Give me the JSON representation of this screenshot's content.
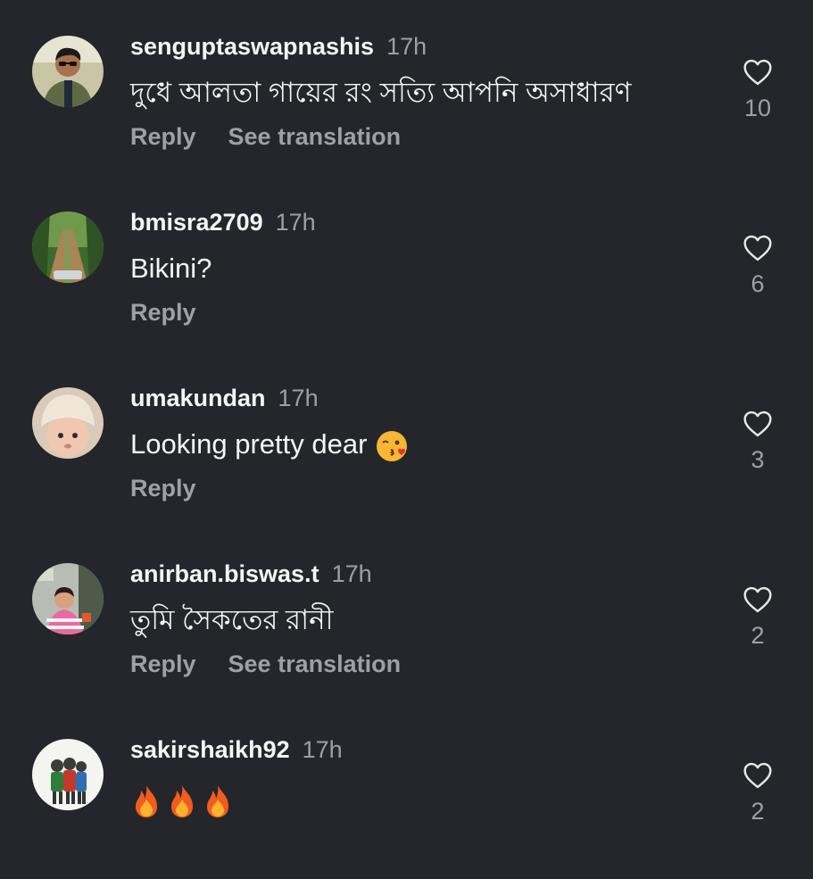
{
  "comments": [
    {
      "username": "senguptaswapnashis",
      "time": "17h",
      "text": "দুধে আলতা গায়ের রং সত্যি আপনি অসাধারণ",
      "reply_label": "Reply",
      "translate_label": "See translation",
      "likes": "10",
      "avatar_icon": "person-sunglasses-avatar"
    },
    {
      "username": "bmisra2709",
      "time": "17h",
      "text": "Bikini?",
      "reply_label": "Reply",
      "likes": "6",
      "avatar_icon": "forest-road-avatar"
    },
    {
      "username": "umakundan",
      "time": "17h",
      "text": "Looking pretty dear",
      "emoji": "kissing-wink-emoji",
      "reply_label": "Reply",
      "likes": "3",
      "avatar_icon": "baby-hat-avatar"
    },
    {
      "username": "anirban.biswas.t",
      "time": "17h",
      "text": "তুমি সৈকতের রানী",
      "reply_label": "Reply",
      "translate_label": "See translation",
      "likes": "2",
      "avatar_icon": "child-room-avatar"
    },
    {
      "username": "sakirshaikh92",
      "time": "17h",
      "text": "",
      "emoji": "fire-emoji",
      "emoji_count": 3,
      "likes": "2",
      "avatar_icon": "friends-drawing-avatar"
    }
  ],
  "colors": {
    "background": "#25262b",
    "primary_text": "#f5f5f5",
    "secondary_text": "#9fa0a5"
  }
}
